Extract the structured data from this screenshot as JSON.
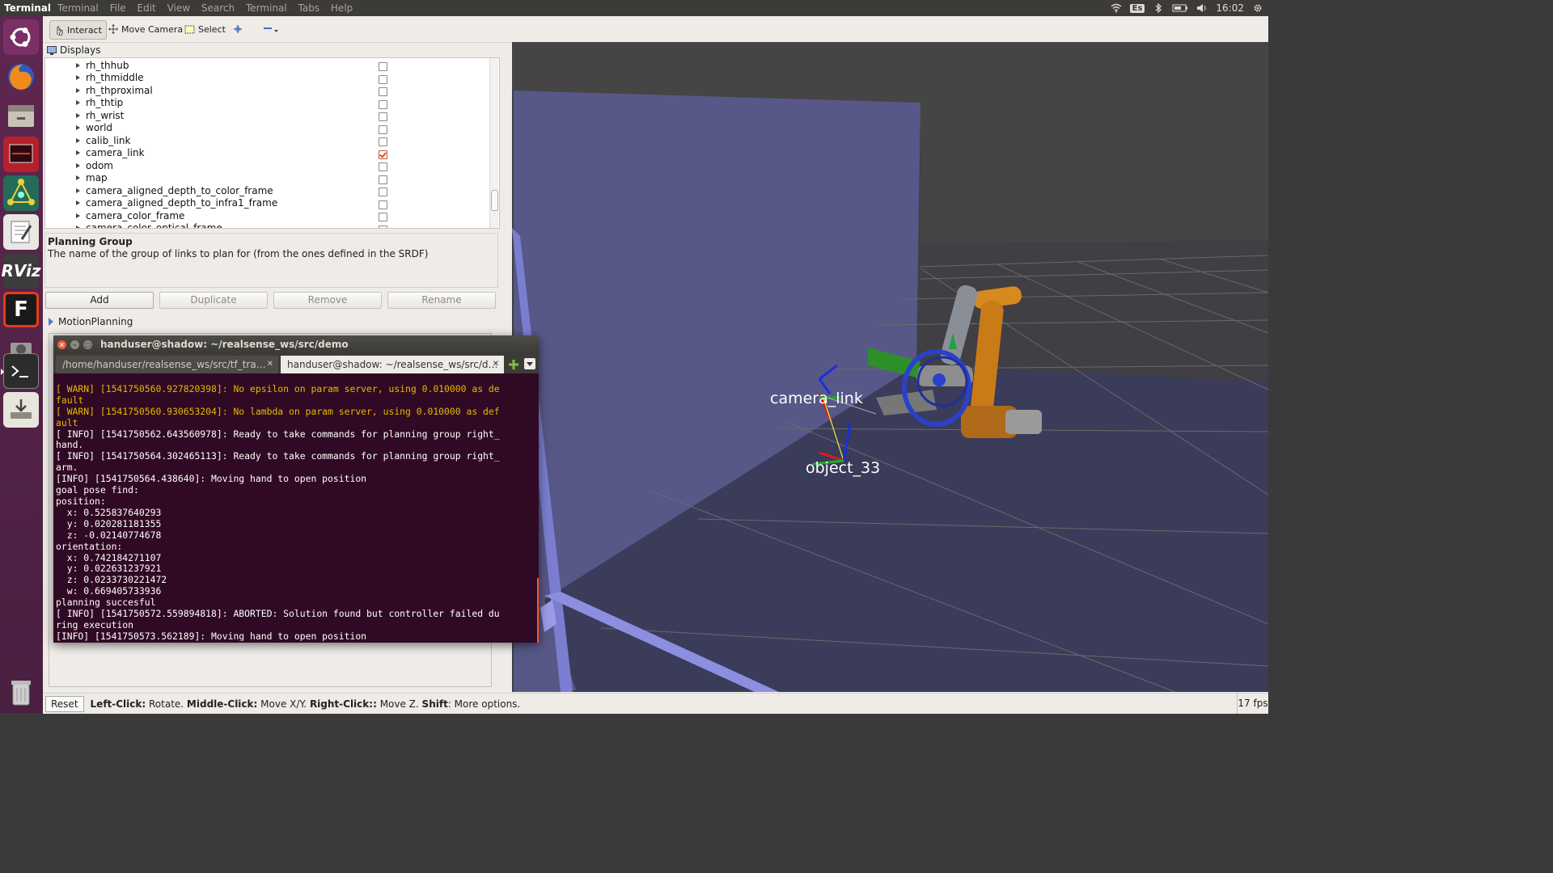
{
  "topbar": {
    "app_name": "Terminal",
    "menus": [
      "Terminal",
      "File",
      "Edit",
      "View",
      "Search",
      "Terminal",
      "Tabs",
      "Help"
    ],
    "keyboard_layout": "Es",
    "clock": "16:02"
  },
  "launcher": {
    "items": [
      "ubuntu-dash",
      "firefox",
      "files",
      "terminal-red",
      "network-app",
      "text-editor",
      "rviz",
      "flexbe",
      "camera",
      "terminal",
      "installer",
      "trash"
    ],
    "rviz_label": "RViz",
    "f_label": "F"
  },
  "rviz": {
    "toolbar": {
      "interact": "Interact",
      "move_camera": "Move Camera",
      "select": "Select"
    },
    "displays": {
      "title": "Displays",
      "tree": [
        {
          "label": "rh_thhub",
          "checked": false
        },
        {
          "label": "rh_thmiddle",
          "checked": false
        },
        {
          "label": "rh_thproximal",
          "checked": false
        },
        {
          "label": "rh_thtip",
          "checked": false
        },
        {
          "label": "rh_wrist",
          "checked": false
        },
        {
          "label": "world",
          "checked": false
        },
        {
          "label": "calib_link",
          "checked": false
        },
        {
          "label": "camera_link",
          "checked": true
        },
        {
          "label": "odom",
          "checked": false
        },
        {
          "label": "map",
          "checked": false
        },
        {
          "label": "camera_aligned_depth_to_color_frame",
          "checked": false
        },
        {
          "label": "camera_aligned_depth_to_infra1_frame",
          "checked": false
        },
        {
          "label": "camera_color_frame",
          "checked": false
        },
        {
          "label": "camera_color_optical_frame",
          "checked": false
        }
      ],
      "description_title": "Planning Group",
      "description_text": "The name of the group of links to plan for (from the ones defined in the SRDF)",
      "buttons": {
        "add": "Add",
        "duplicate": "Duplicate",
        "remove": "Remove",
        "rename": "Rename"
      }
    },
    "motion_planning_title": "MotionPlanning",
    "view": {
      "labels": {
        "camera_link": "camera_link",
        "object": "object_33"
      }
    },
    "status": {
      "reset": "Reset",
      "left_click_key": "Left-Click:",
      "left_click_text": " Rotate. ",
      "middle_click_key": "Middle-Click:",
      "middle_click_text": " Move X/Y. ",
      "right_click_key": "Right-Click::",
      "right_click_text": " Move Z. ",
      "shift_key": "Shift",
      "shift_text": ": More options.",
      "fps": "17 fps"
    }
  },
  "terminal": {
    "title": "handuser@shadow: ~/realsense_ws/src/demo",
    "tabs": [
      {
        "label": "/home/handuser/realsense_ws/src/tf_tra…",
        "active": false
      },
      {
        "label": "handuser@shadow: ~/realsense_ws/src/d…",
        "active": true
      }
    ],
    "lines": [
      {
        "text": "[ WARN] [1541750560.927820398]: No epsilon on param server, using 0.010000 as de",
        "warn": true
      },
      {
        "text": "fault",
        "warn": true
      },
      {
        "text": "[ WARN] [1541750560.930653204]: No lambda on param server, using 0.010000 as def",
        "warn": true
      },
      {
        "text": "ault",
        "warn": true
      },
      {
        "text": "[ INFO] [1541750562.643560978]: Ready to take commands for planning group right_",
        "warn": false
      },
      {
        "text": "hand.",
        "warn": false
      },
      {
        "text": "[ INFO] [1541750564.302465113]: Ready to take commands for planning group right_",
        "warn": false
      },
      {
        "text": "arm.",
        "warn": false
      },
      {
        "text": "[INFO] [1541750564.438640]: Moving hand to open position",
        "warn": false
      },
      {
        "text": "goal pose find:",
        "warn": false
      },
      {
        "text": "position:",
        "warn": false
      },
      {
        "text": "  x: 0.525837640293",
        "warn": false
      },
      {
        "text": "  y: 0.020281181355",
        "warn": false
      },
      {
        "text": "  z: -0.02140774678",
        "warn": false
      },
      {
        "text": "orientation:",
        "warn": false
      },
      {
        "text": "  x: 0.742184271107",
        "warn": false
      },
      {
        "text": "  y: 0.022631237921",
        "warn": false
      },
      {
        "text": "  z: 0.0233730221472",
        "warn": false
      },
      {
        "text": "  w: 0.669405733936",
        "warn": false
      },
      {
        "text": "planning succesful",
        "warn": false
      },
      {
        "text": "[ INFO] [1541750572.559894818]: ABORTED: Solution found but controller failed du",
        "warn": false
      },
      {
        "text": "ring execution",
        "warn": false
      },
      {
        "text": "[INFO] [1541750573.562189]: Moving hand to open position",
        "warn": false
      }
    ]
  }
}
